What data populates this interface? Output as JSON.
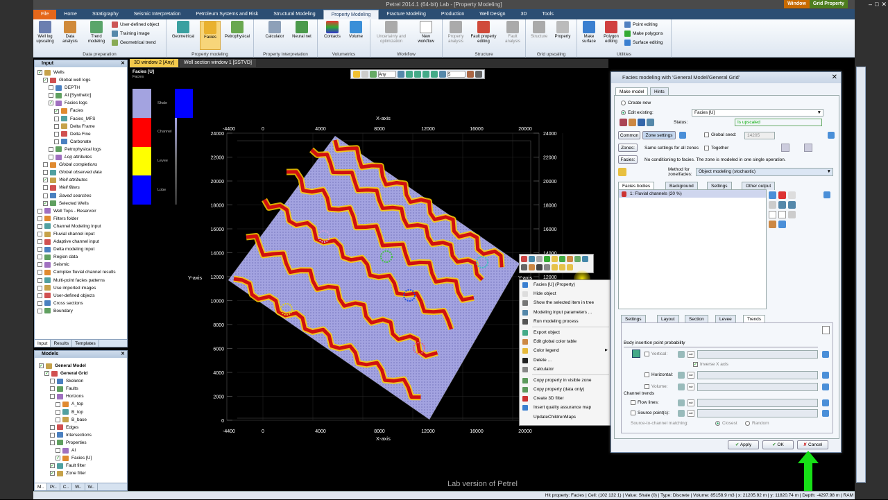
{
  "window": {
    "title": "Petrel 2014.1 (64-bit) Lab - [Property Modeling]",
    "context_tabs": [
      "Window",
      "Grid Property"
    ]
  },
  "ribbon": {
    "tabs": [
      "File",
      "Home",
      "Stratigraphy",
      "Seismic Interpretation",
      "Petroleum Systems and Risk",
      "Structural Modeling",
      "Property Modeling",
      "Fracture Modeling",
      "Production",
      "Well Design",
      "3D",
      "Tools"
    ],
    "active_tab": "Property Modeling",
    "groups": [
      {
        "label": "Data preparation",
        "buttons": [
          "Well log upscaling",
          "Data analysis",
          "Trend modeling"
        ],
        "small": [
          "User-defined object",
          "Training image",
          "Geometrical trend"
        ]
      },
      {
        "label": "Property modeling",
        "buttons": [
          "Geometrical",
          "Facies",
          "Petrophysical"
        ]
      },
      {
        "label": "Property Interpretation",
        "buttons": [
          "Calculator",
          "Neural net"
        ]
      },
      {
        "label": "Volumetrics",
        "buttons": [
          "Contacts",
          "Volume"
        ]
      },
      {
        "label": "Workflow",
        "buttons": [
          "Uncertainty and optimization",
          "New workflow"
        ]
      },
      {
        "label": "Structure",
        "buttons": [
          "Property analysis",
          "Fault property editing",
          "Fault analysis"
        ]
      },
      {
        "label": "Grid upscaling",
        "buttons": [
          "Structure",
          "Property"
        ]
      },
      {
        "label": "Utilities",
        "buttons": [
          "Make surface",
          "Polygon editing"
        ],
        "small": [
          "Point editing",
          "Make polygons",
          "Surface editing"
        ]
      }
    ]
  },
  "input_panel": {
    "title": "Input",
    "items": [
      {
        "label": "Wells",
        "indent": 0,
        "checked": true
      },
      {
        "label": "Global well logs",
        "indent": 1,
        "checked": true
      },
      {
        "label": "DEPTH",
        "indent": 2,
        "checked": false
      },
      {
        "label": "AI [Synthetic]",
        "indent": 2,
        "checked": false
      },
      {
        "label": "Facies logs",
        "indent": 2,
        "checked": true
      },
      {
        "label": "Facies",
        "indent": 3,
        "checked": true
      },
      {
        "label": "Facies_MFS",
        "indent": 3,
        "checked": false
      },
      {
        "label": "Delta Frame",
        "indent": 3,
        "checked": false
      },
      {
        "label": "Delta Fine",
        "indent": 3,
        "checked": false
      },
      {
        "label": "Carbonate",
        "indent": 3,
        "checked": false
      },
      {
        "label": "Petrophysical logs",
        "indent": 2,
        "checked": false
      },
      {
        "label": "Log attributes",
        "indent": 2,
        "checked": false
      },
      {
        "label": "Global completions",
        "indent": 1,
        "checked": false
      },
      {
        "label": "Global observed data",
        "indent": 1,
        "checked": false
      },
      {
        "label": "Well attributes",
        "indent": 1,
        "checked": true
      },
      {
        "label": "Well filters",
        "indent": 1,
        "checked": false
      },
      {
        "label": "Saved searches",
        "indent": 1,
        "checked": false
      },
      {
        "label": "Selected Wells",
        "indent": 1,
        "checked": true
      },
      {
        "label": "Well Tops - Reservoir",
        "indent": 0,
        "checked": false
      },
      {
        "label": "Filters folder",
        "indent": 0,
        "checked": false
      },
      {
        "label": "Channel Modeling Input",
        "indent": 0,
        "checked": false
      },
      {
        "label": "Fluvial channel input",
        "indent": 0,
        "checked": false
      },
      {
        "label": "Adaptive channel input",
        "indent": 0,
        "checked": false
      },
      {
        "label": "Delta modeling input",
        "indent": 0,
        "checked": false
      },
      {
        "label": "Region data",
        "indent": 0,
        "checked": false
      },
      {
        "label": "Seismic",
        "indent": 0,
        "checked": false
      },
      {
        "label": "Complex fluvial channel results",
        "indent": 0,
        "checked": false
      },
      {
        "label": "Multi-point facies patterns",
        "indent": 0,
        "checked": false
      },
      {
        "label": "Use imported images",
        "indent": 0,
        "checked": false
      },
      {
        "label": "User-defined objects",
        "indent": 0,
        "checked": false
      },
      {
        "label": "Cross sections",
        "indent": 0,
        "checked": false
      },
      {
        "label": "Boundary",
        "indent": 0,
        "checked": false
      }
    ],
    "bottom_tabs": [
      "Input",
      "Results",
      "Templates"
    ]
  },
  "models_panel": {
    "title": "Models",
    "items": [
      {
        "label": "General Model",
        "indent": 0,
        "checked": true,
        "bold": true
      },
      {
        "label": "General Grid",
        "indent": 1,
        "checked": true,
        "bold": true
      },
      {
        "label": "Skeleton",
        "indent": 2,
        "checked": false
      },
      {
        "label": "Faults",
        "indent": 2,
        "checked": false
      },
      {
        "label": "Horizons",
        "indent": 2,
        "checked": false
      },
      {
        "label": "A_top",
        "indent": 3,
        "checked": false
      },
      {
        "label": "B_top",
        "indent": 3,
        "checked": false
      },
      {
        "label": "B_base",
        "indent": 3,
        "checked": false
      },
      {
        "label": "Edges",
        "indent": 2,
        "checked": false
      },
      {
        "label": "Intersections",
        "indent": 2,
        "checked": false
      },
      {
        "label": "Properties",
        "indent": 2,
        "checked": false
      },
      {
        "label": "AI",
        "indent": 3,
        "checked": false
      },
      {
        "label": "Facies [U]",
        "indent": 3,
        "checked": true
      },
      {
        "label": "Fault filter",
        "indent": 2,
        "checked": true
      },
      {
        "label": "Zone filter",
        "indent": 2,
        "checked": true
      }
    ],
    "bottom_tabs": [
      "M..",
      "Pr..",
      "C..",
      "W..",
      "W.."
    ]
  },
  "doc_tabs": [
    "3D window 2 [Any]",
    "Well section window 1 [SSTVD]"
  ],
  "viewport": {
    "legend_title": "Facies [U]",
    "legend_subtitle": "Facies",
    "legend": [
      {
        "label": "Shale",
        "color": "#a3a3e0"
      },
      {
        "label": "Channel",
        "color": "#ff0000"
      },
      {
        "label": "Levee",
        "color": "#ffff00"
      },
      {
        "label": "Lobe",
        "color": "#0000ff"
      }
    ],
    "x_axis_label": "X-axis",
    "y_axis_label": "Y-axis",
    "x_ticks": [
      "-4400",
      "0",
      "4000",
      "8000",
      "12000",
      "16000",
      "20000"
    ],
    "y_ticks": [
      "24000",
      "22000",
      "20000",
      "18000",
      "16000",
      "14000",
      "12000",
      "10000",
      "8000",
      "6000",
      "4000",
      "2000",
      "0"
    ],
    "y_tick_extra": "-4400",
    "zoom_value": "5",
    "view_mode": "Any",
    "overlay_text": "Lab version of Petrel"
  },
  "context_menu": {
    "items": [
      {
        "label": "Facies [U] (Property)",
        "icon": "info-icon",
        "disabled": false
      },
      {
        "label": "Hide object",
        "icon": "hide-icon",
        "disabled": false
      },
      {
        "label": "Show the selected item in tree",
        "icon": "tree-icon",
        "disabled": false
      },
      {
        "label": "Modeling input parameters ...",
        "icon": "grid-icon",
        "disabled": false
      },
      {
        "label": "Run modeling process",
        "icon": "process-icon",
        "disabled": false
      },
      {
        "label": "Export object",
        "icon": "export-icon",
        "disabled": false
      },
      {
        "label": "Edit global color table",
        "icon": "color-table-icon",
        "disabled": false
      },
      {
        "label": "Color legend",
        "icon": "check-icon",
        "disabled": false,
        "submenu": true
      },
      {
        "label": "Delete ...",
        "icon": "delete-icon",
        "disabled": false
      },
      {
        "label": "Calculator",
        "icon": "calculator-icon",
        "disabled": false
      },
      {
        "label": "Copy property in visible zone",
        "icon": "copy-icon",
        "disabled": false
      },
      {
        "label": "Copy property (data only)",
        "icon": "copy-icon",
        "disabled": false
      },
      {
        "label": "Create 3D filter",
        "icon": "filter-icon",
        "disabled": false
      },
      {
        "label": "Insert quality assurance map",
        "icon": "map-icon",
        "disabled": false
      },
      {
        "label": "UpdateChildrenMaps",
        "icon": "",
        "disabled": false
      }
    ]
  },
  "dialog": {
    "title": "Facies modeling with 'General Model/General Grid'",
    "tabs": [
      "Make model",
      "Hints"
    ],
    "create_new": "Create new",
    "edit_existing": "Edit existing:",
    "property": "Facies [U]",
    "status_label": "Status:",
    "status_value": "Is upscaled",
    "common_btn": "Common",
    "zone_settings_btn": "Zone settings",
    "global_seed_label": "Global seed:",
    "global_seed_value": "14205",
    "zones_btn": "Zones:",
    "zones_text": "Same settings for all zones",
    "together_label": "Together",
    "facies_btn": "Facies:",
    "facies_text": "No conditioning to facies. The zone is modeled in one single operation.",
    "method_label": "Method for zone/facies:",
    "method_value": "Object modeling (stochastic)",
    "sub_tabs": [
      "Facies bodies",
      "Background",
      "Settings",
      "Other output"
    ],
    "bodies": [
      "1: Fluvial channels (20 %)"
    ],
    "lower_tabs": [
      "Settings",
      "Layout",
      "Section",
      "Levee",
      "Trends"
    ],
    "section_body": "Body insertion point probability",
    "vertical": "Vertical:",
    "inverse_x": "Inverse X axis",
    "horizontal": "Horizontal:",
    "volume": "Volume:",
    "channel_trends": "Channel trends",
    "flow_lines": "Flow lines:",
    "source_points": "Source point(s):",
    "source_matching": "Source-to-channel matching:",
    "closest": "Closest",
    "random": "Random",
    "apply": "Apply",
    "ok": "OK",
    "cancel": "Cancel"
  },
  "status_bar": "Hit property: Facies | Cell: (102 132 1) | Value: Shale (0) | Type: Discrete | Volume: 85158.9 m3 | x: 21205.92 m | y: 11820.74 m | Depth: -4297.98 m | RAM"
}
